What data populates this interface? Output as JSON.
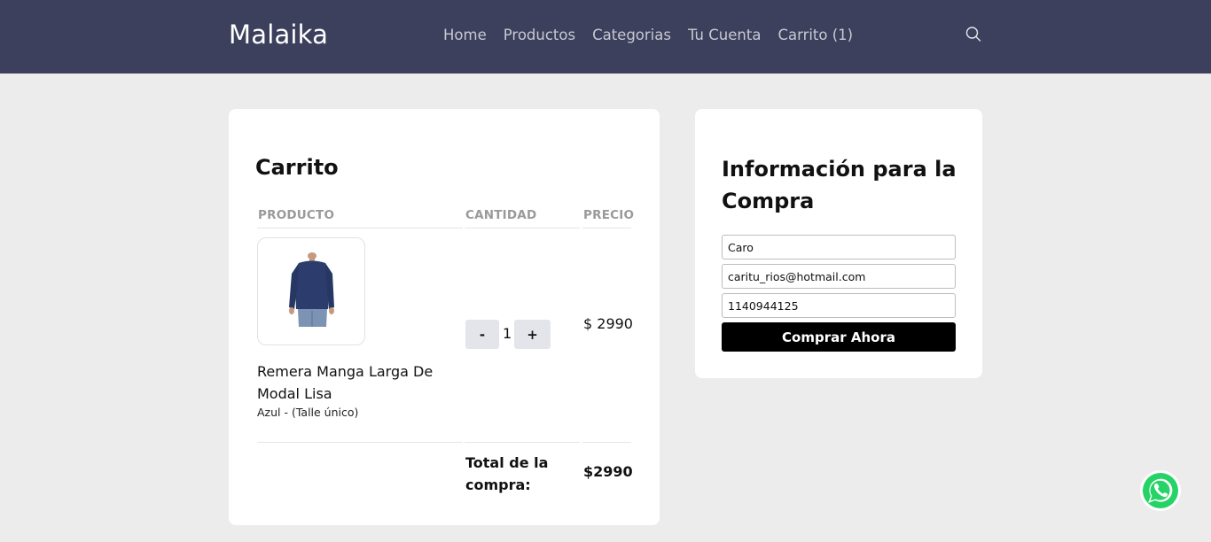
{
  "header": {
    "brand": "Malaika",
    "nav": [
      "Home",
      "Productos",
      "Categorias",
      "Tu Cuenta",
      "Carrito (1)"
    ],
    "search_icon": "search-icon",
    "bg_color": "#3c405c"
  },
  "cart": {
    "title": "Carrito",
    "columns": {
      "product": "PRODUCTO",
      "quantity": "CANTIDAD",
      "price": "PRECIO"
    },
    "items": [
      {
        "name": "Remera Manga Larga De Modal Lisa",
        "variant": "Azul - (Talle único)",
        "quantity": "1",
        "decrement": "-",
        "increment": "+",
        "price": "$ 2990"
      }
    ],
    "total_label": "Total de la compra:",
    "total_value": "$2990"
  },
  "purchase_info": {
    "title": "Información para la Compra",
    "name_value": "Caro",
    "email_value": "caritu_rios@hotmail.com",
    "phone_value": "1140944125",
    "submit_label": "Comprar Ahora"
  },
  "whatsapp": {
    "icon": "whatsapp-icon",
    "color": "#25d366"
  }
}
